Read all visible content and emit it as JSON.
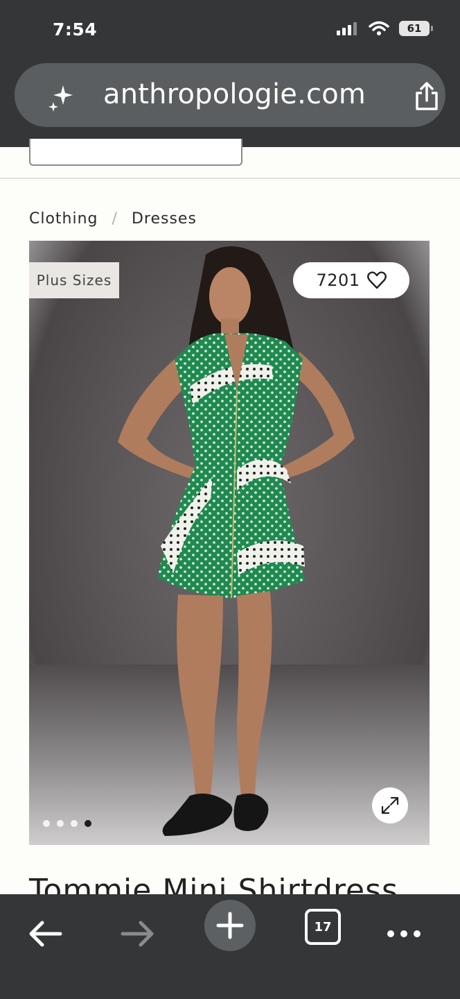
{
  "status_bar": {
    "time": "7:54",
    "battery": "61"
  },
  "browser": {
    "url": "anthropologie.com",
    "tab_count": "17"
  },
  "breadcrumb": {
    "items": [
      "Clothing",
      "Dresses"
    ],
    "separator": "/"
  },
  "product": {
    "badge": "Plus Sizes",
    "favorites_count": "7201",
    "title": "Tommie Mini Shirtdress",
    "image_count": 4,
    "active_image": 4
  },
  "colors": {
    "chrome": "#343637",
    "url_pill": "#5b5e60",
    "page_bg": "#fdfdf9",
    "dress_green": "#1f8a4f"
  },
  "icons": [
    "sparkle-icon",
    "share-icon",
    "heart-icon",
    "expand-icon",
    "back-arrow-icon",
    "forward-arrow-icon",
    "plus-icon",
    "more-icon"
  ]
}
